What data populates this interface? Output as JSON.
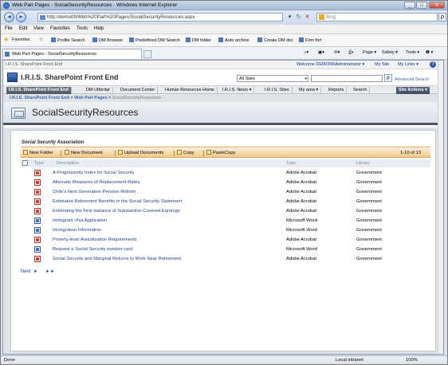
{
  "window": {
    "title": "Web Part Pages - SocialSecurityResources - Windows Internet Explorer",
    "min_label": "_",
    "max_label": "□",
    "close_label": "X"
  },
  "addressbar": {
    "back_label": "◄",
    "fwd_label": "►",
    "url": "http://demo09/Web%20Part%20Pages/SocialSecurityResources.aspx",
    "search_placeholder": "Bing",
    "go_label": "ρ"
  },
  "menubar": {
    "items": [
      "File",
      "Edit",
      "View",
      "Favorites",
      "Tools",
      "Help"
    ]
  },
  "favorites": {
    "label": "Favorites",
    "items": [
      "Profile Search",
      "DM Browser",
      "Predefined DM Search",
      "DM folder",
      "Auto archive",
      "Create DM doc",
      "Firm fort"
    ]
  },
  "tabs": {
    "active": "Web Part Pages - SocialSecurityResources",
    "commands": [
      "Page ▾",
      "Safety ▾",
      "Tools ▾",
      "❶ ▾"
    ]
  },
  "sharepoint": {
    "site_name": "I.R.I.S. SharePoint Front End",
    "user": "Welcome DEMO09\\Administrator ▾",
    "my_site": "My Site",
    "my_links": "My Links ▾",
    "help": "?",
    "title": "I.R.I.S. SharePoint Front End",
    "scope": "All Sites",
    "advanced_search": "Advanced Search",
    "nav": [
      "I.R.I.S. SharePoint Front End",
      "DM Utfordar",
      "Document Center",
      "Human Resources Home",
      "I.R.I.S. News ▾",
      "I.R.I.S. Sites",
      "My area ▾",
      "Reports",
      "Search"
    ],
    "site_actions": "Site Actions ▾",
    "breadcrumb": {
      "root": "I.R.I.S. SharePoint Front End",
      "sep1": ">",
      "parent": "Web Part Pages",
      "sep2": ">",
      "current": "SocialSecurityResources"
    },
    "page_title": "SocialSecurityResources"
  },
  "webpart": {
    "title": "Social Security Association",
    "toolbar": {
      "new_folder": "New Folder",
      "new_document": "New Document",
      "upload": "Upload Documents",
      "copy": "Copy",
      "paste": "PasteCopy",
      "count": "1-10 of 13"
    },
    "columns": {
      "type": "Type",
      "description": "Description",
      "doctype": "Type",
      "library": "Library"
    },
    "rows": [
      {
        "icon": "pdf",
        "description": "A Progressivity Index for Social Security",
        "type": "Adobe Acrobat",
        "library": "Government"
      },
      {
        "icon": "pdf",
        "description": "Alternate Measures of Replacement Rates",
        "type": "Adobe Acrobat",
        "library": "Government"
      },
      {
        "icon": "pdf",
        "description": "Chile's Next Generation Pension Reform",
        "type": "Adobe Acrobat",
        "library": "Government"
      },
      {
        "icon": "pdf",
        "description": "Estimated Retirement Benefits in the Social Security Statement",
        "type": "Adobe Acrobat",
        "library": "Government"
      },
      {
        "icon": "pdf",
        "description": "Estimating the First Instance of Substantive-Covered Earnings",
        "type": "Adobe Acrobat",
        "library": "Government"
      },
      {
        "icon": "doc",
        "description": "Immigrant Visa Application",
        "type": "Microsoft Word",
        "library": "Government"
      },
      {
        "icon": "doc",
        "description": "Immigration Information",
        "type": "Microsoft Word",
        "library": "Government"
      },
      {
        "icon": "pdf",
        "description": "Poverty-level Annuitization Requirements",
        "type": "Adobe Acrobat",
        "library": "Government"
      },
      {
        "icon": "doc",
        "description": "Request a Social Security number card",
        "type": "Microsoft Word",
        "library": "Government"
      },
      {
        "icon": "pdf",
        "description": "Social Security and Marginal Returns to Work Near Retirement",
        "type": "Adobe Acrobat",
        "library": "Government"
      }
    ],
    "pager": {
      "next": "Next",
      "next_arrow": "►",
      "last_arrow": "►►"
    }
  },
  "statusbar": {
    "text": "Done",
    "zone": "Local intranet",
    "zoom": "100%"
  }
}
